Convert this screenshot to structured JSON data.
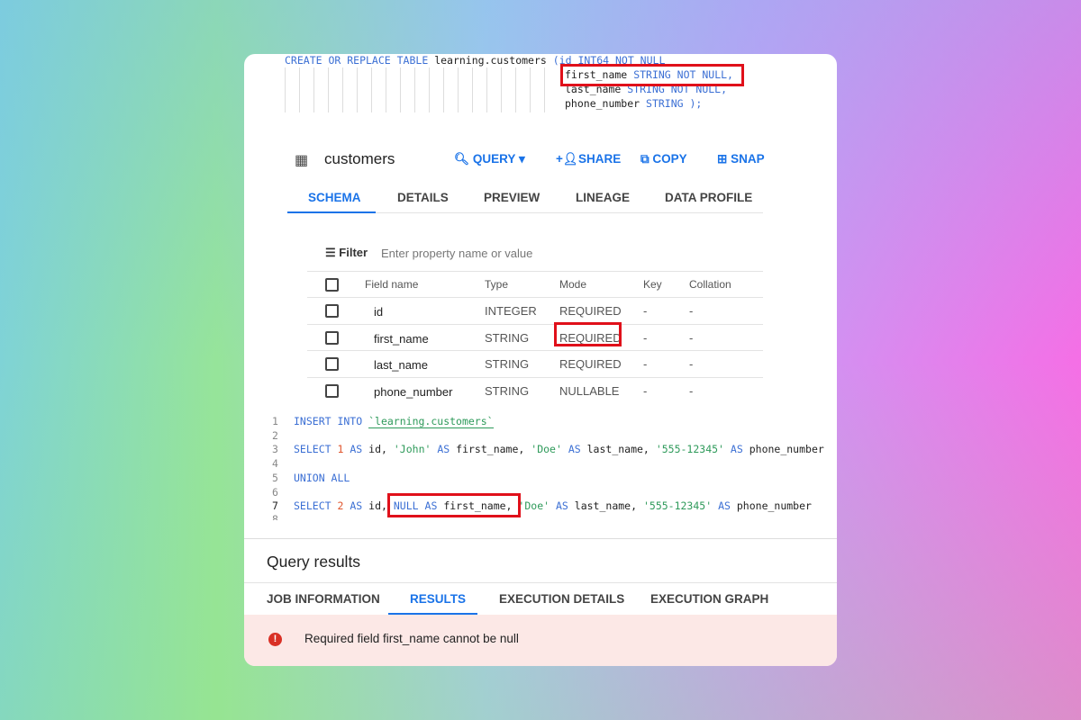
{
  "ddl": {
    "line1_kw": "CREATE OR REPLACE TABLE",
    "line1_id": "learning.customers",
    "line1_tail": "(id INT64 NOT NULL",
    "line2_id": "first_name",
    "line2_kw": "STRING NOT NULL,",
    "line3_id": "last_name",
    "line3_kw": "STRING NOT NULL,",
    "line4_id": "phone_number",
    "line4_kw": "STRING );"
  },
  "table": {
    "name": "customers",
    "actions": [
      "QUERY",
      "SHARE",
      "COPY",
      "SNAP"
    ],
    "tabs": [
      "SCHEMA",
      "DETAILS",
      "PREVIEW",
      "LINEAGE",
      "DATA PROFILE"
    ],
    "active_tab": "SCHEMA"
  },
  "filter": {
    "label": "Filter",
    "placeholder": "Enter property name or value"
  },
  "schema": {
    "headers": [
      "Field name",
      "Type",
      "Mode",
      "Key",
      "Collation"
    ],
    "rows": [
      [
        "id",
        "INTEGER",
        "REQUIRED",
        "-",
        "-"
      ],
      [
        "first_name",
        "STRING",
        "REQUIRED",
        "-",
        "-"
      ],
      [
        "last_name",
        "STRING",
        "REQUIRED",
        "-",
        "-"
      ],
      [
        "phone_number",
        "STRING",
        "NULLABLE",
        "-",
        "-"
      ]
    ]
  },
  "editor": {
    "line_numbers": [
      "1",
      "2",
      "3",
      "4",
      "5",
      "6",
      "7",
      "8"
    ],
    "l1": {
      "kw": "INSERT INTO",
      "tbl": "`learning.customers`"
    },
    "l3": {
      "a": "SELECT",
      "b": "1",
      "c": "AS",
      "d": "id,",
      "e": "'John'",
      "f": "AS",
      "g": "first_name,",
      "h": "'Doe'",
      "i": "AS",
      "j": "last_name,",
      "k": "'555-12345'",
      "l": "AS",
      "m": "phone_number"
    },
    "l5": "UNION ALL",
    "l7": {
      "a": "SELECT",
      "b": "2",
      "c": "AS",
      "d": "id,",
      "e": "NULL",
      "f": "AS",
      "g": "first_name,",
      "h": "'Doe'",
      "i": "AS",
      "j": "last_name,",
      "k": "'555-12345'",
      "l": "AS",
      "m": "phone_number"
    }
  },
  "results": {
    "title": "Query results",
    "tabs": [
      "JOB INFORMATION",
      "RESULTS",
      "EXECUTION DETAILS",
      "EXECUTION GRAPH"
    ],
    "active_tab": "RESULTS",
    "error": "Required field first_name cannot be null"
  },
  "colors": {
    "accent": "#1a73e8",
    "highlight": "#e0101a",
    "error_bg": "#fce8e6",
    "error_icon": "#d93025"
  }
}
